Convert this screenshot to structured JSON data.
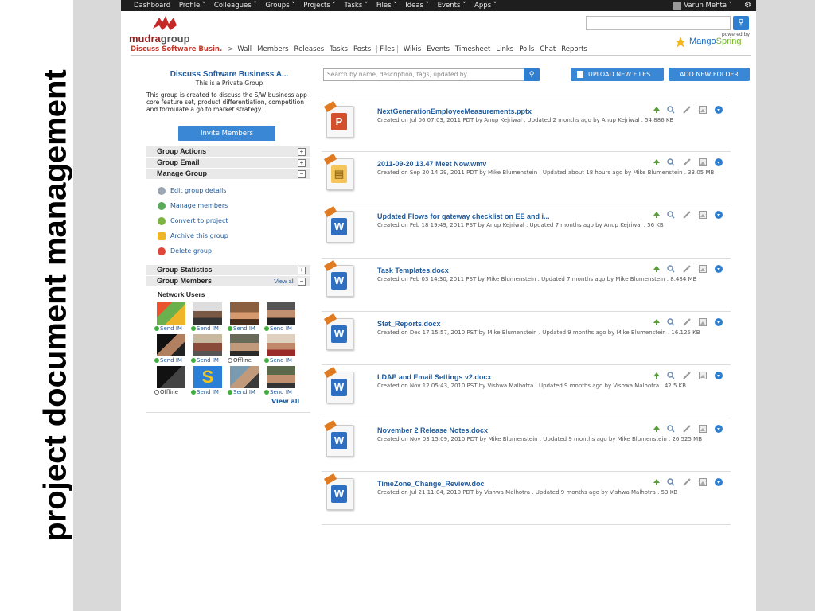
{
  "slide": {
    "caption": "project document management"
  },
  "topnav": {
    "items": [
      "Dashboard",
      "Profile ˅",
      "Colleagues ˅",
      "Groups ˅",
      "Projects ˅",
      "Tasks ˅",
      "Files ˅",
      "Ideas ˅",
      "Events ˅",
      "Apps ˅"
    ],
    "user": "Varun Mehta ˅"
  },
  "header": {
    "logo_prefix": "mudra",
    "logo_suffix": "group",
    "powered_by": "powered by",
    "mango_prefix": "Mango",
    "mango_suffix": "Spring"
  },
  "group_tabs": {
    "group_name": "Discuss Software Busin.",
    "separator": ">",
    "tabs": [
      "Wall",
      "Members",
      "Releases",
      "Tasks",
      "Posts",
      "Files",
      "Wikis",
      "Events",
      "Timesheet",
      "Links",
      "Polls",
      "Chat",
      "Reports"
    ],
    "active": "Files"
  },
  "sidebar": {
    "title": "Discuss Software Business A...",
    "subtitle": "This is a Private Group",
    "description": "This group is created to discuss the S/W business app core feature set, product differentiation, competition and formulate a go to market strategy.",
    "invite_label": "Invite Members",
    "sections": {
      "group_actions": "Group Actions",
      "group_email": "Group Email",
      "manage_group": "Manage Group",
      "group_statistics": "Group Statistics",
      "group_members": "Group Members"
    },
    "manage_items": [
      "Edit group details",
      "Manage members",
      "Convert to project",
      "Archive this group",
      "Delete group"
    ],
    "view_all": "View all",
    "network_users": "Network Users",
    "members": [
      {
        "status": "Send IM",
        "online": true
      },
      {
        "status": "Send IM",
        "online": true
      },
      {
        "status": "Send IM",
        "online": true
      },
      {
        "status": "Send IM",
        "online": true
      },
      {
        "status": "Send IM",
        "online": true
      },
      {
        "status": "Send IM",
        "online": true
      },
      {
        "status": "Offline",
        "online": false
      },
      {
        "status": "Send IM",
        "online": true
      },
      {
        "status": "Offline",
        "online": false
      },
      {
        "status": "Send IM",
        "online": true
      },
      {
        "status": "Send IM",
        "online": true
      },
      {
        "status": "Send IM",
        "online": true
      }
    ],
    "view_all_members": "View all"
  },
  "files": {
    "search_placeholder": "Search by name, description, tags, updated by",
    "upload_label": "UPLOAD NEW FILES",
    "add_folder_label": "ADD NEW FOLDER",
    "items": [
      {
        "name": "NextGenerationEmployeeMeasurements.pptx",
        "meta": "Created on Jul 06 07:03, 2011 PDT by Anup Kejriwal  .  Updated 2 months ago by Anup Kejriwal  .  54.886 KB",
        "type": "ppt"
      },
      {
        "name": "2011-09-20 13.47 Meet Now.wmv",
        "meta": "Created on Sep 20 14:29, 2011 PDT by Mike Blumenstein  .  Updated about 18 hours ago by Mike Blumenstein  .  33.05 MB",
        "type": "video"
      },
      {
        "name": "Updated Flows for gateway checklist on EE and i...",
        "meta": "Created on Feb 18 19:49, 2011 PST by Anup Kejriwal  .  Updated 7 months ago by Anup Kejriwal  .  56 KB",
        "type": "word"
      },
      {
        "name": "Task Templates.docx",
        "meta": "Created on Feb 03 14:30, 2011 PST by Mike Blumenstein  .  Updated 7 months ago by Mike Blumenstein  .  8.484 MB",
        "type": "word"
      },
      {
        "name": "Stat_Reports.docx",
        "meta": "Created on Dec 17 15:57, 2010 PST by Mike Blumenstein  .  Updated 9 months ago by Mike Blumenstein  .  16.125 KB",
        "type": "word"
      },
      {
        "name": "LDAP and Email Settings v2.docx",
        "meta": "Created on Nov 12 05:43, 2010 PST by Vishwa Malhotra  .  Updated 9 months ago by Vishwa Malhotra  .  42.5 KB",
        "type": "word"
      },
      {
        "name": "November 2 Release Notes.docx",
        "meta": "Created on Nov 03 15:09, 2010 PDT by Mike Blumenstein  .  Updated 9 months ago by Mike Blumenstein  .  26.525 MB",
        "type": "word"
      },
      {
        "name": "TimeZone_Change_Review.doc",
        "meta": "Created on Jul 21 11:04, 2010 PDT by Vishwa Malhotra  .  Updated 9 months ago by Vishwa Malhotra  .  53 KB",
        "type": "word"
      }
    ]
  },
  "colors": {
    "nav_bg": "#1e1e1e",
    "link_blue": "#1e5a9c",
    "button_blue": "#3a87d6",
    "group_red": "#c0392b",
    "online_green": "#3fae3f"
  }
}
